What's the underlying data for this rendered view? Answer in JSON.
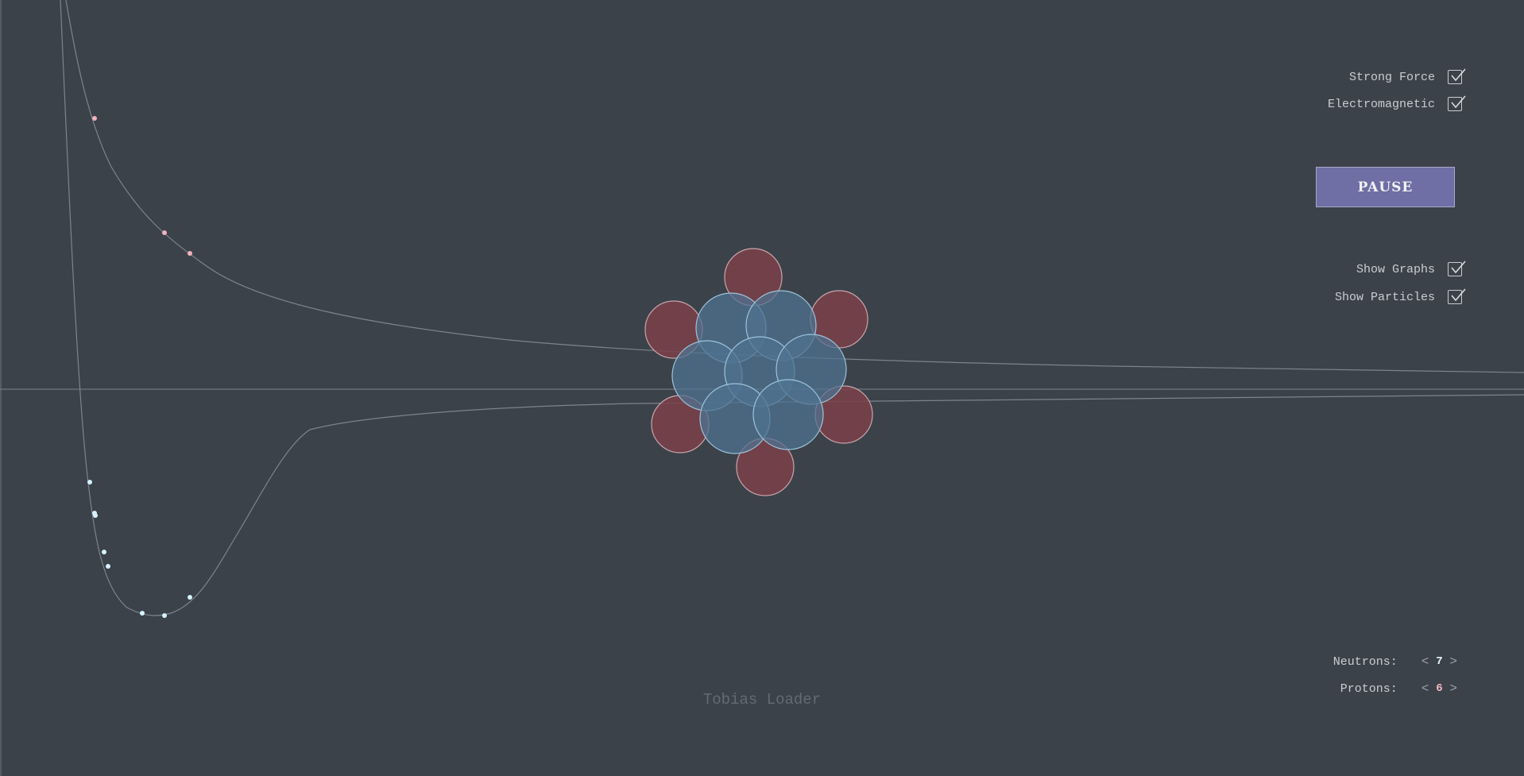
{
  "controls": {
    "strong_force": {
      "label": "Strong Force",
      "checked": true
    },
    "electromagnetic": {
      "label": "Electromagnetic",
      "checked": true
    },
    "pause_label": "PAUSE",
    "show_graphs": {
      "label": "Show Graphs",
      "checked": true
    },
    "show_particles": {
      "label": "Show Particles",
      "checked": true
    }
  },
  "counters": {
    "neutrons": {
      "label": "Neutrons:",
      "value": "7",
      "prev": "<",
      "next": ">"
    },
    "protons": {
      "label": "Protons:",
      "value": "6",
      "prev": "<",
      "next": ">"
    }
  },
  "author": "Tobias Loader",
  "colors": {
    "background": "#3c424a",
    "proton_fill": "#7a3f48",
    "neutron_fill": "#4f7390",
    "neutron_value": "#e6f6ff",
    "proton_value": "#f2b8c0",
    "proton_marker": "#f0b4bc",
    "neutron_marker": "#d6f2ff",
    "curve": "#7d848c"
  },
  "nucleus": {
    "neutrons": 7,
    "protons": 6
  }
}
